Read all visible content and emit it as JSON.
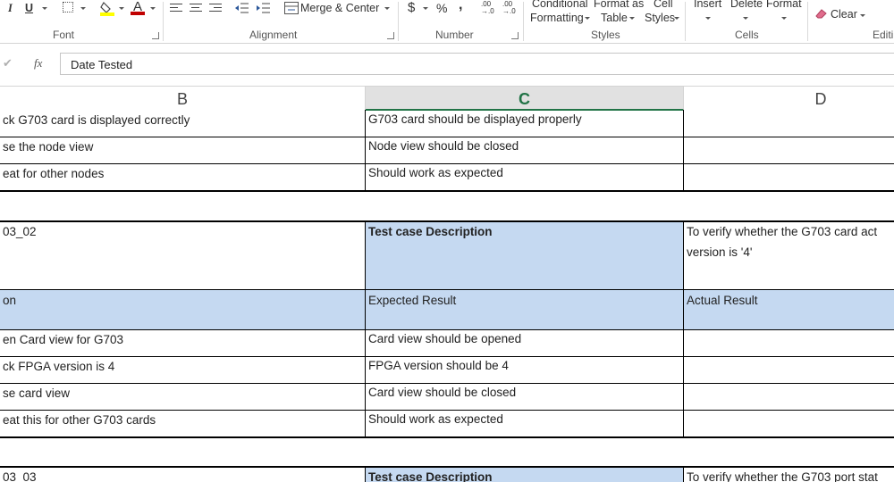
{
  "ribbon": {
    "groups": {
      "font": "Font",
      "alignment": "Alignment",
      "number": "Number",
      "styles": "Styles",
      "cells": "Cells",
      "editing": "Editi"
    },
    "buttons": {
      "italic": "I",
      "underline": "U",
      "merge_center": "Merge & Center",
      "currency": "$",
      "percent": "%",
      "comma": ",",
      "increase_decimal_top": ".00",
      "increase_decimal_bottom": "→.0",
      "decrease_decimal_top": ".00",
      "decrease_decimal_bottom": "→.0",
      "conditional_formatting_1": "Conditional",
      "conditional_formatting_2": "Formatting",
      "format_as_table_1": "Format as",
      "format_as_table_2": "Table",
      "cell_styles_1": "Cell",
      "cell_styles_2": "Styles",
      "insert": "Insert",
      "delete": "Delete",
      "format": "Format",
      "clear": "Clear"
    },
    "colors": {
      "fill_color": "#ffff00",
      "font_color": "#c00000"
    }
  },
  "formula_bar": {
    "check": "✔",
    "fx": "fx",
    "value": "Date Tested"
  },
  "columns": {
    "b": "B",
    "c": "C",
    "d": "D"
  },
  "rows": {
    "r1": {
      "b": "ck G703 card is displayed correctly",
      "c": "G703 card should be displayed properly",
      "d": ""
    },
    "r2": {
      "b": "se the node view",
      "c": "Node view should be closed",
      "d": ""
    },
    "r3": {
      "b": "eat for other nodes",
      "c": "Should work as expected",
      "d": ""
    },
    "r5": {
      "b": "03_02",
      "c": "Test case Description",
      "d_line1": "To verify whether the G703 card act",
      "d_line2": "version is '4'"
    },
    "r6": {
      "b": "on",
      "c": "Expected Result",
      "d": "Actual Result"
    },
    "r7": {
      "b": "en Card view for G703",
      "c": "Card view should be opened",
      "d": ""
    },
    "r8": {
      "b": "ck FPGA version is  4",
      "c": "FPGA version should be 4",
      "d": ""
    },
    "r9": {
      "b": "se card view",
      "c": "Card view should be closed",
      "d": ""
    },
    "r10": {
      "b": "eat this for other G703 cards",
      "c": "Should work as expected",
      "d": ""
    },
    "r12": {
      "b": "03_03",
      "c": "Test case Description",
      "d": "To verify whether the G703 port stat"
    }
  },
  "colors": {
    "header_blue": "#c5d9f1",
    "excel_green": "#217346"
  }
}
